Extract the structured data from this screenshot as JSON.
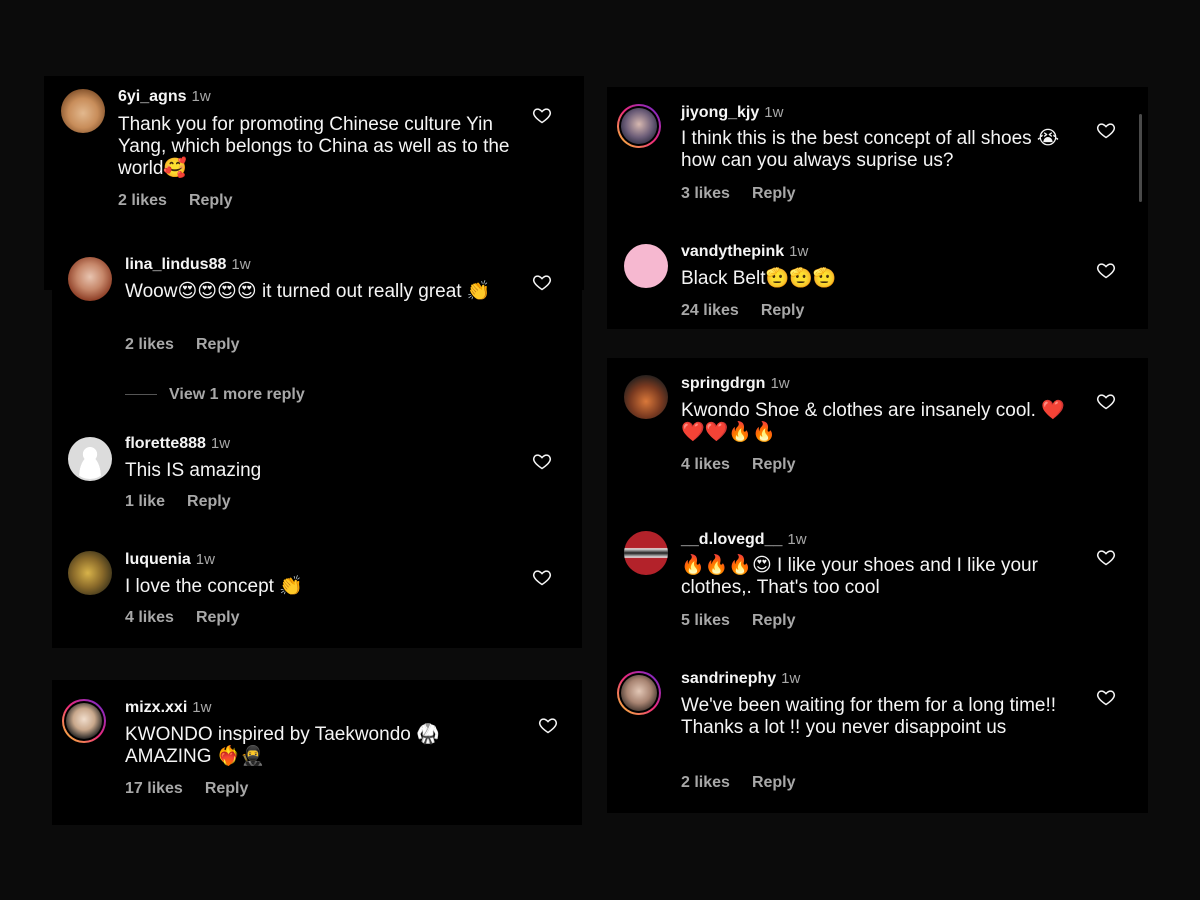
{
  "heart_icon": "heart-outline-icon",
  "reply_label": "Reply",
  "left_top": [
    {
      "user": "6yi_agns",
      "time": "1w",
      "text": "Thank you for promoting Chinese culture Yin Yang, which belongs to China as well as to the world🥰",
      "likes": "2 likes"
    },
    {
      "user": "lina_lindus88",
      "time": "1w",
      "text": "Woow😍😍😍😍 it turned out really great 👏",
      "likes": "2 likes"
    },
    {
      "user": "florette888",
      "time": "1w",
      "text": "This IS amazing",
      "likes": "1 like"
    },
    {
      "user": "luquenia",
      "time": "1w",
      "text": "I love the concept 👏",
      "likes": "4 likes"
    }
  ],
  "view_more": "View 1 more reply",
  "left_bottom": {
    "user": "mizx.xxi",
    "time": "1w",
    "text": "KWONDO inspired by Taekwondo 🥋 AMAZING ❤️‍🔥🥷",
    "likes": "17 likes"
  },
  "right_top": [
    {
      "user": "jiyong_kjy",
      "time": "1w",
      "text": "I think this is the best concept of all shoes 😭 how can you always suprise us?",
      "likes": "3 likes"
    },
    {
      "user": "vandythepink",
      "time": "1w",
      "text": "Black Belt🫡🫡🫡",
      "likes": "24 likes"
    }
  ],
  "right_bottom": [
    {
      "user": "springdrgn",
      "time": "1w",
      "text": "Kwondo Shoe & clothes are insanely cool. ❤️❤️❤️🔥🔥",
      "likes": "4 likes"
    },
    {
      "user": "__d.lovegd__",
      "time": "1w",
      "text": "🔥🔥🔥😍 I like your shoes and I like your clothes,. That's too cool",
      "likes": "5 likes"
    },
    {
      "user": "sandrinephy",
      "time": "1w",
      "text": "We've been waiting for them for a long time!! Thanks a lot !! you never disappoint us",
      "likes": "2 likes"
    }
  ],
  "colors": {
    "background": "#0b0b0b",
    "panel": "#000000",
    "muted": "#a8a8a8",
    "text": "#f5f5f5",
    "pink_avatar": "#f6b8d0"
  }
}
